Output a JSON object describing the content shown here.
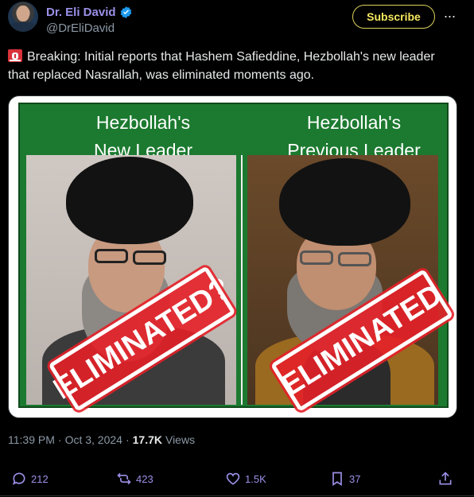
{
  "author": {
    "name": "Dr. Eli David",
    "handle": "@DrEliDavid",
    "verified": true
  },
  "header": {
    "subscribe_label": "Subscribe",
    "more_icon": "more-dots-icon"
  },
  "tweet": {
    "text": "Breaking: Initial reports that Hashem Safieddine, Hezbollah's new leader that replaced Nasrallah, was eliminated moments ago.",
    "leading_emoji": "siren-icon"
  },
  "media": {
    "left_title_line1": "Hezbollah's",
    "left_title_line2": "New Leader",
    "right_title_line1": "Hezbollah's",
    "right_title_line2": "Previous Leader",
    "left_stamp": "ELIMINATED?",
    "right_stamp": "ELIMINATED",
    "background_color": "#1c7a30"
  },
  "meta": {
    "time": "11:39 PM",
    "separator": "·",
    "date": "Oct 3, 2024",
    "views_count": "17.7K",
    "views_label": "Views"
  },
  "actions": {
    "replies": "212",
    "reposts": "423",
    "likes": "1.5K",
    "bookmarks": "37"
  },
  "colors": {
    "accent": "#9b90e8",
    "subscribe_border": "#dcd15c",
    "stamp_red": "#e62028"
  }
}
